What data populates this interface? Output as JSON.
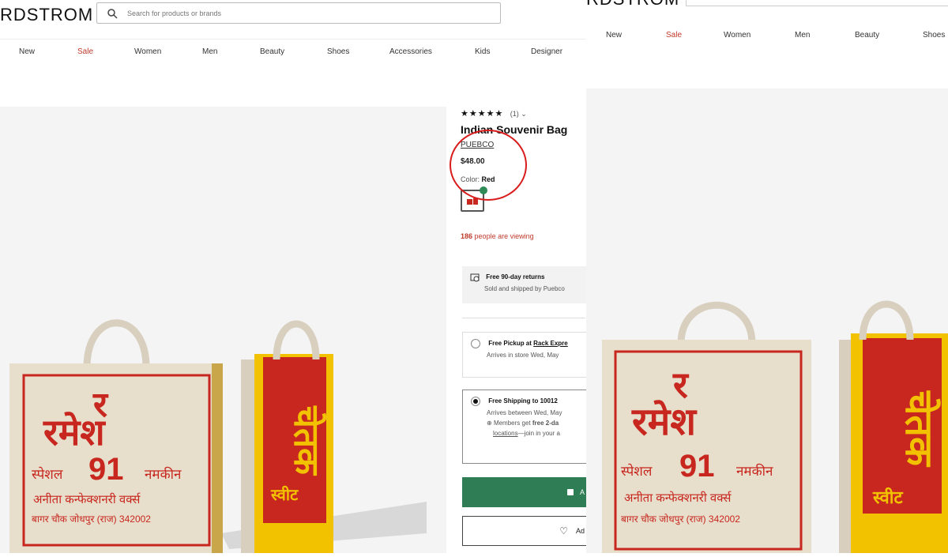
{
  "header": {
    "logo": "RDSTROM",
    "logo_right": "RDSTROM",
    "search_placeholder": "Search for products or brands"
  },
  "nav": [
    "New",
    "Sale",
    "Women",
    "Men",
    "Beauty",
    "Shoes",
    "Accessories",
    "Kids",
    "Designer"
  ],
  "nav_right": [
    "New",
    "Sale",
    "Women",
    "Men",
    "Beauty",
    "Shoes"
  ],
  "product": {
    "stars": "★★★★★",
    "rating_count": "(1) ⌄",
    "title": "Indian Souvenir Bag",
    "brand": "PUEBCO",
    "price": "$48.00",
    "color_label": "Color:",
    "color_value": "Red",
    "viewing_count": "186",
    "viewing_text": "people are viewing"
  },
  "returns": {
    "title": "Free 90-day returns",
    "subtitle": "Sold and shipped by Puebco"
  },
  "pickup": {
    "title_prefix": "Free Pickup at",
    "title_link": "Rack Expre",
    "subtitle": "Arrives in store Wed, May"
  },
  "shipping": {
    "title": "Free Shipping to 10012",
    "subtitle": "Arrives between Wed, May",
    "members_prefix": "Members get",
    "members_bold": "free 2-da",
    "locations_link": "locations",
    "join_text": "—join in your a"
  },
  "buttons": {
    "add_to_bag": "A",
    "add_to_wishlist": "Ad"
  },
  "bag_text": {
    "left_big": "र",
    "left_word": "रमेश",
    "left_special": "स्पेशल",
    "left_num": "91",
    "left_namkeen": "नमकीन",
    "left_line3": "अनीता कन्फेक्शनरी वर्क्स",
    "left_line4": "बागर चौक जोधपुर (राज) 342002",
    "right_word": "चेतक",
    "right_sweet": "स्वीट"
  },
  "colors": {
    "sale": "#c0392b",
    "annotation_circle": "#d91c1c",
    "add_button": "#2e7d55",
    "bag_red": "#c8271f",
    "bag_yellow": "#f2c200"
  }
}
